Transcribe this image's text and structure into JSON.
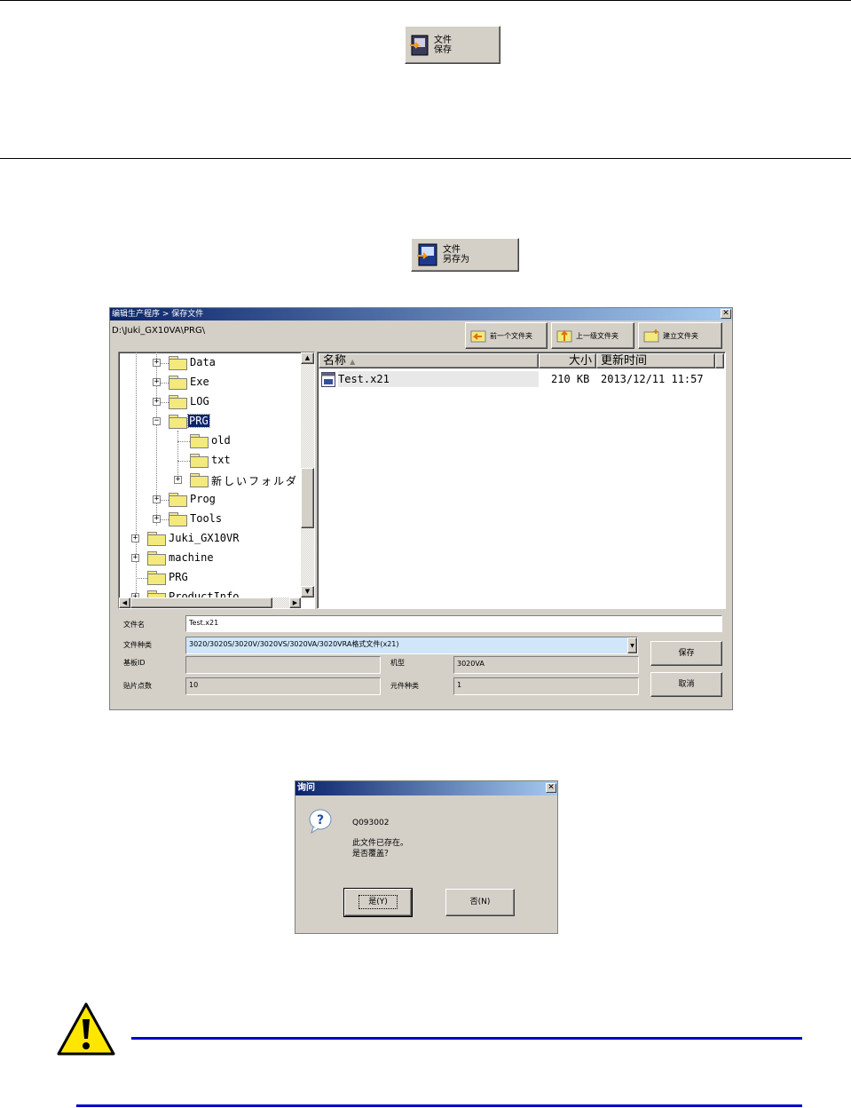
{
  "top_button": {
    "line1": "文件",
    "line2": "保存"
  },
  "saveas_button": {
    "line1": "文件",
    "line2": "另存为"
  },
  "dialog": {
    "title": "编辑生产程序 > 保存文件",
    "path": "D:\\Juki_GX10VA\\PRG\\",
    "toolbar": {
      "back": "前一个文件夹",
      "up": "上一级文件夹",
      "new_folder": "建立文件夹"
    },
    "tree": {
      "items": [
        {
          "label": "Data"
        },
        {
          "label": "Exe"
        },
        {
          "label": "LOG"
        },
        {
          "label": "PRG"
        },
        {
          "label": "old"
        },
        {
          "label": "txt"
        },
        {
          "label": "新しいフォルダ"
        },
        {
          "label": "Prog"
        },
        {
          "label": "Tools"
        },
        {
          "label": "Juki_GX10VR"
        },
        {
          "label": "machine"
        },
        {
          "label": "PRG"
        },
        {
          "label": "ProductInfo"
        }
      ]
    },
    "list": {
      "col_name": "名称",
      "col_size": "大小",
      "col_date": "更新时间",
      "rows": [
        {
          "name": "Test.x21",
          "size": "210 KB",
          "date": "2013/12/11 11:57"
        }
      ]
    },
    "form": {
      "filename_label": "文件名",
      "filename_value": "Test.x21",
      "filetype_label": "文件种类",
      "filetype_value": "3020/3020S/3020V/3020VS/3020VA/3020VRA格式文件(x21)",
      "board_id_label": "基板ID",
      "board_id_value": "",
      "model_label": "机型",
      "model_value": "3020VA",
      "points_label": "贴片点数",
      "points_value": "10",
      "parts_label": "元件种类",
      "parts_value": "1",
      "save_btn": "保存",
      "cancel_btn": "取消"
    }
  },
  "confirm": {
    "title": "询问",
    "code": "Q093002",
    "line1": "此文件已存在。",
    "line2": "是否覆盖？",
    "yes": "是(Y)",
    "no": "否(N)"
  },
  "colors": {
    "accent_line": "#0000cc",
    "titlebar": "#0a246a",
    "selection": "#0a246a"
  }
}
